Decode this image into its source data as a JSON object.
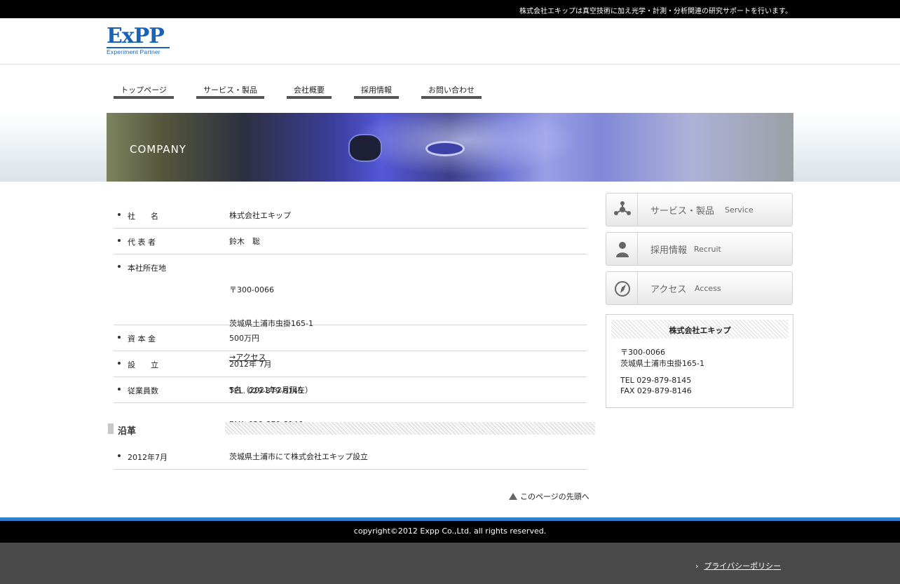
{
  "topbar": {
    "tagline": "株式会社エキップは真空技術に加え光学・計測・分析関連の研究サポートを行います。"
  },
  "logo": {
    "main": "ExPP",
    "sub": "Experiment Partner"
  },
  "nav": [
    {
      "label": "トップページ"
    },
    {
      "label": "サービス・製品"
    },
    {
      "label": "会社概要"
    },
    {
      "label": "採用情報"
    },
    {
      "label": "お問い合わせ"
    }
  ],
  "banner": {
    "title": "COMPANY"
  },
  "company": {
    "rows": [
      {
        "label": "社　　名",
        "value": "株式会社エキップ"
      },
      {
        "label": "代 表 者",
        "value": "鈴木　聡"
      },
      {
        "label": "本社所在地",
        "postal": "〒300-0066",
        "address": "茨城県土浦市虫掛165-1",
        "access_link": "→アクセス",
        "tel": "TEL. 029-879-8145",
        "fax": "FAX. 029-879-8146"
      },
      {
        "label": "資 本 金",
        "value": "500万円"
      },
      {
        "label": "設　　立",
        "value": "2012年 7月"
      },
      {
        "label": "従業員数",
        "value": "5名（2021年2月現在）"
      }
    ]
  },
  "history": {
    "title": "沿革",
    "rows": [
      {
        "label": "2012年7月",
        "value": "茨城県土浦市にて株式会社エキップ設立"
      }
    ]
  },
  "pagetop": {
    "label": "このページの先頭へ"
  },
  "sidebar": {
    "buttons": [
      {
        "jp": "サービス・製品",
        "en": "Service",
        "icon": "network-icon"
      },
      {
        "jp": "採用情報",
        "en": "Recruit",
        "icon": "person-icon"
      },
      {
        "jp": "アクセス",
        "en": "Access",
        "icon": "compass-icon"
      }
    ],
    "address": {
      "name": "株式会社エキップ",
      "postal": "〒300-0066",
      "address": "茨城県土浦市虫掛165-1",
      "tel": "TEL 029-879-8145",
      "fax": "FAX 029-879-8146"
    }
  },
  "footer": {
    "copyright": "copyright©2012 Expp Co.,Ltd. all rights reserved.",
    "privacy": "プライバシーポリシー"
  },
  "colors": {
    "accent": "#2f7fd0",
    "brand": "#1a62b5",
    "footer_dark": "#000000",
    "subfooter": "#4a4a4a"
  }
}
